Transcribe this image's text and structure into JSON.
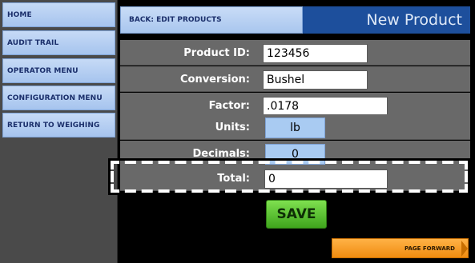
{
  "sidebar": {
    "items": [
      {
        "label": "HOME"
      },
      {
        "label": "AUDIT TRAIL"
      },
      {
        "label": "OPERATOR MENU"
      },
      {
        "label": "CONFIGURATION MENU"
      },
      {
        "label": "RETURN TO WEIGHING"
      }
    ]
  },
  "header": {
    "back_label": "BACK: EDIT PRODUCTS",
    "title": "New Product"
  },
  "form": {
    "product_id": {
      "label": "Product ID:",
      "value": "123456"
    },
    "conversion": {
      "label": "Conversion:",
      "value": "Bushel"
    },
    "factor": {
      "label": "Factor:",
      "value": ".0178"
    },
    "units": {
      "label": "Units:",
      "value": "lb"
    },
    "decimals": {
      "label": "Decimals:",
      "value": "0"
    },
    "total": {
      "label": "Total:",
      "value": "0"
    }
  },
  "actions": {
    "save_label": "SAVE",
    "page_forward_label": "PAGE FORWARD"
  },
  "colors": {
    "nav_button": "#b7cff3",
    "title_bar": "#1d4f9c",
    "row_background": "#696969",
    "save_button": "#5cc236",
    "page_forward": "#f5a022"
  }
}
